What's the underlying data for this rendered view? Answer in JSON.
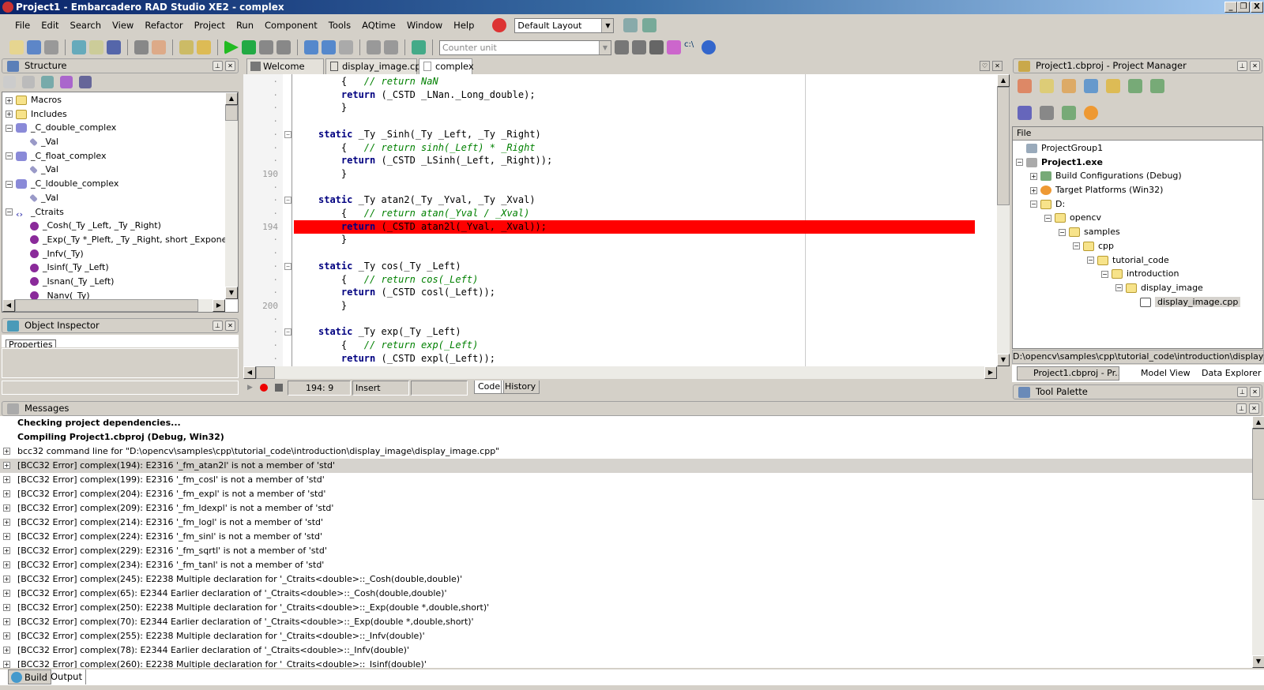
{
  "window": {
    "title": "Project1 - Embarcadero RAD Studio XE2 - complex",
    "minimize": "_",
    "restore": "❐",
    "close": "X"
  },
  "menu": [
    "File",
    "Edit",
    "Search",
    "View",
    "Refactor",
    "Project",
    "Run",
    "Component",
    "Tools",
    "AQtime",
    "Window",
    "Help"
  ],
  "layout_combo": "Default Layout",
  "counter_unit_placeholder": "Counter unit",
  "structure": {
    "title": "Structure",
    "items": [
      {
        "label": "Macros",
        "indent": 0,
        "exp": "+",
        "icon": "folder"
      },
      {
        "label": "Includes",
        "indent": 0,
        "exp": "+",
        "icon": "folder"
      },
      {
        "label": "_C_double_complex",
        "indent": 0,
        "exp": "-",
        "icon": "cube"
      },
      {
        "label": "_Val",
        "indent": 1,
        "exp": "",
        "icon": "fld"
      },
      {
        "label": "_C_float_complex",
        "indent": 0,
        "exp": "-",
        "icon": "cube"
      },
      {
        "label": "_Val",
        "indent": 1,
        "exp": "",
        "icon": "fld"
      },
      {
        "label": "_C_ldouble_complex",
        "indent": 0,
        "exp": "-",
        "icon": "cube"
      },
      {
        "label": "_Val",
        "indent": 1,
        "exp": "",
        "icon": "fld"
      },
      {
        "label": "_Ctraits",
        "indent": 0,
        "exp": "-",
        "icon": "template"
      },
      {
        "label": "_Cosh(_Ty _Left, _Ty _Right)",
        "indent": 1,
        "exp": "",
        "icon": "meth"
      },
      {
        "label": "_Exp(_Ty *_Pleft, _Ty _Right, short _Exponent",
        "indent": 1,
        "exp": "",
        "icon": "meth"
      },
      {
        "label": "_Infv(_Ty)",
        "indent": 1,
        "exp": "",
        "icon": "meth"
      },
      {
        "label": "_Isinf(_Ty _Left)",
        "indent": 1,
        "exp": "",
        "icon": "meth"
      },
      {
        "label": "_Isnan(_Ty _Left)",
        "indent": 1,
        "exp": "",
        "icon": "meth"
      },
      {
        "label": "_Nanv(_Ty)",
        "indent": 1,
        "exp": "",
        "icon": "meth"
      }
    ]
  },
  "object_inspector": {
    "title": "Object Inspector",
    "tab": "Properties"
  },
  "editor": {
    "tabs": [
      "Welcome Page",
      "display_image.cpp",
      "complex"
    ],
    "active_tab": "complex",
    "lines": [
      {
        "n": "",
        "code": [
          [
            "",
            "    {   "
          ],
          [
            "cm",
            "// return NaN"
          ]
        ]
      },
      {
        "n": "",
        "code": [
          [
            "kw",
            "    return"
          ],
          [
            "",
            " (_CSTD _LNan._Long_double);"
          ]
        ]
      },
      {
        "n": "",
        "code": [
          [
            "",
            "    }"
          ]
        ]
      },
      {
        "n": "",
        "code": []
      },
      {
        "n": "",
        "fold": true,
        "code": [
          [
            "kw",
            "static"
          ],
          [
            "",
            " _Ty _Sinh(_Ty _Left, _Ty _Right)"
          ]
        ]
      },
      {
        "n": "",
        "code": [
          [
            "",
            "    {   "
          ],
          [
            "cm",
            "// return sinh(_Left) * _Right"
          ]
        ]
      },
      {
        "n": "",
        "code": [
          [
            "kw",
            "    return"
          ],
          [
            "",
            " (_CSTD _LSinh(_Left, _Right));"
          ]
        ]
      },
      {
        "n": "190",
        "code": [
          [
            "",
            "    }"
          ]
        ]
      },
      {
        "n": "",
        "code": []
      },
      {
        "n": "",
        "fold": true,
        "code": [
          [
            "kw",
            "static"
          ],
          [
            "",
            " _Ty atan2(_Ty _Yval, _Ty _Xval)"
          ]
        ]
      },
      {
        "n": "",
        "code": [
          [
            "",
            "    {   "
          ],
          [
            "cm",
            "// return atan(_Yval / _Xval)"
          ]
        ]
      },
      {
        "n": "194",
        "error": true,
        "code": [
          [
            "kw",
            "    return"
          ],
          [
            "",
            " (_CSTD atan2l(_Yval, _Xval));"
          ]
        ]
      },
      {
        "n": "",
        "code": [
          [
            "",
            "    }"
          ]
        ]
      },
      {
        "n": "",
        "code": []
      },
      {
        "n": "",
        "fold": true,
        "code": [
          [
            "kw",
            "static"
          ],
          [
            "",
            " _Ty cos(_Ty _Left)"
          ]
        ]
      },
      {
        "n": "",
        "code": [
          [
            "",
            "    {   "
          ],
          [
            "cm",
            "// return cos(_Left)"
          ]
        ]
      },
      {
        "n": "",
        "code": [
          [
            "kw",
            "    return"
          ],
          [
            "",
            " (_CSTD cosl(_Left));"
          ]
        ]
      },
      {
        "n": "200",
        "code": [
          [
            "",
            "    }"
          ]
        ]
      },
      {
        "n": "",
        "code": []
      },
      {
        "n": "",
        "fold": true,
        "code": [
          [
            "kw",
            "static"
          ],
          [
            "",
            " _Ty exp(_Ty _Left)"
          ]
        ]
      },
      {
        "n": "",
        "code": [
          [
            "",
            "    {   "
          ],
          [
            "cm",
            "// return exp(_Left)"
          ]
        ]
      },
      {
        "n": "",
        "code": [
          [
            "kw",
            "    return"
          ],
          [
            "",
            " (_CSTD expl(_Left));"
          ]
        ]
      }
    ],
    "status": {
      "position": "194:  9",
      "mode": "Insert",
      "tabs": [
        "Code",
        "History"
      ]
    },
    "error_line_color": "#ff0000"
  },
  "project_manager": {
    "title": "Project1.cbproj - Project Manager",
    "column": "File",
    "items": [
      {
        "label": "ProjectGroup1",
        "indent": 0,
        "exp": "",
        "icon": "group"
      },
      {
        "label": "Project1.exe",
        "indent": 0,
        "exp": "-",
        "icon": "exe",
        "bold": true
      },
      {
        "label": "Build Configurations (Debug)",
        "indent": 1,
        "exp": "+",
        "icon": "build"
      },
      {
        "label": "Target Platforms (Win32)",
        "indent": 1,
        "exp": "+",
        "icon": "target"
      },
      {
        "label": "D:",
        "indent": 1,
        "exp": "-",
        "icon": "folder"
      },
      {
        "label": "opencv",
        "indent": 2,
        "exp": "-",
        "icon": "folder"
      },
      {
        "label": "samples",
        "indent": 3,
        "exp": "-",
        "icon": "folder"
      },
      {
        "label": "cpp",
        "indent": 4,
        "exp": "-",
        "icon": "folder"
      },
      {
        "label": "tutorial_code",
        "indent": 5,
        "exp": "-",
        "icon": "folder"
      },
      {
        "label": "introduction",
        "indent": 6,
        "exp": "-",
        "icon": "folder"
      },
      {
        "label": "display_image",
        "indent": 7,
        "exp": "-",
        "icon": "folder"
      },
      {
        "label": "display_image.cpp",
        "indent": 8,
        "exp": "",
        "icon": "file",
        "selected": true
      }
    ],
    "path": "D:\\opencv\\samples\\cpp\\tutorial_code\\introduction\\display_image\\",
    "tabs": [
      "Project1.cbproj - Pr...",
      "Model View",
      "Data Explorer"
    ],
    "tool_palette": "Tool Palette"
  },
  "messages": {
    "title": "Messages",
    "rows": [
      {
        "text": "Checking project dependencies...",
        "bold": true,
        "exp": false
      },
      {
        "text": "Compiling Project1.cbproj (Debug, Win32)",
        "bold": true,
        "exp": false
      },
      {
        "text": "bcc32 command line for \"D:\\opencv\\samples\\cpp\\tutorial_code\\introduction\\display_image\\display_image.cpp\"",
        "exp": true
      },
      {
        "text": "[BCC32 Error] complex(194): E2316 '_fm_atan2l' is not a member of 'std'",
        "exp": true,
        "selected": true
      },
      {
        "text": "[BCC32 Error] complex(199): E2316 '_fm_cosl' is not a member of 'std'",
        "exp": true
      },
      {
        "text": "[BCC32 Error] complex(204): E2316 '_fm_expl' is not a member of 'std'",
        "exp": true
      },
      {
        "text": "[BCC32 Error] complex(209): E2316 '_fm_ldexpl' is not a member of 'std'",
        "exp": true
      },
      {
        "text": "[BCC32 Error] complex(214): E2316 '_fm_logl' is not a member of 'std'",
        "exp": true
      },
      {
        "text": "[BCC32 Error] complex(224): E2316 '_fm_sinl' is not a member of 'std'",
        "exp": true
      },
      {
        "text": "[BCC32 Error] complex(229): E2316 '_fm_sqrtl' is not a member of 'std'",
        "exp": true
      },
      {
        "text": "[BCC32 Error] complex(234): E2316 '_fm_tanl' is not a member of 'std'",
        "exp": true
      },
      {
        "text": "[BCC32 Error] complex(245): E2238 Multiple declaration for '_Ctraits<double>::_Cosh(double,double)'",
        "exp": true
      },
      {
        "text": "[BCC32 Error] complex(65): E2344 Earlier declaration of '_Ctraits<double>::_Cosh(double,double)'",
        "exp": true
      },
      {
        "text": "[BCC32 Error] complex(250): E2238 Multiple declaration for '_Ctraits<double>::_Exp(double *,double,short)'",
        "exp": true
      },
      {
        "text": "[BCC32 Error] complex(70): E2344 Earlier declaration of '_Ctraits<double>::_Exp(double *,double,short)'",
        "exp": true
      },
      {
        "text": "[BCC32 Error] complex(255): E2238 Multiple declaration for '_Ctraits<double>::_Infv(double)'",
        "exp": true
      },
      {
        "text": "[BCC32 Error] complex(78): E2344 Earlier declaration of '_Ctraits<double>::_Infv(double)'",
        "exp": true
      },
      {
        "text": "[BCC32 Error] complex(260): E2238 Multiple declaration for '_Ctraits<double>::_Isinf(double)'",
        "exp": true
      }
    ],
    "tabs": [
      "Build",
      "Output"
    ]
  }
}
